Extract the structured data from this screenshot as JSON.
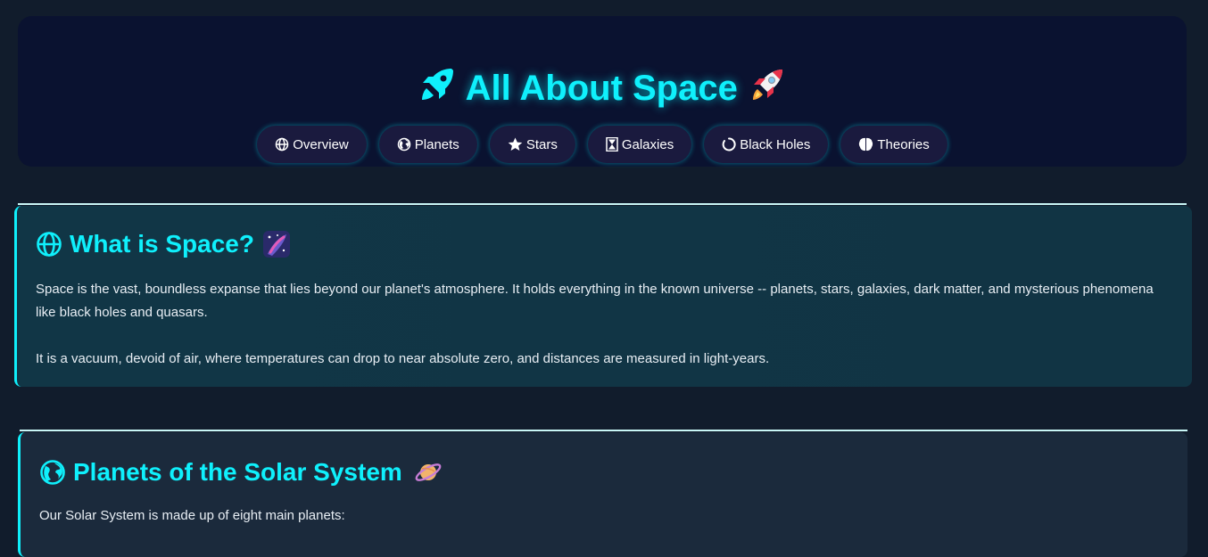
{
  "header": {
    "title": "All About Space",
    "nav": [
      {
        "label": "Overview",
        "icon": "globe-icon"
      },
      {
        "label": "Planets",
        "icon": "earth-icon"
      },
      {
        "label": "Stars",
        "icon": "star-icon"
      },
      {
        "label": "Galaxies",
        "icon": "hourglass-icon"
      },
      {
        "label": "Black Holes",
        "icon": "ring-icon"
      },
      {
        "label": "Theories",
        "icon": "brain-icon"
      }
    ]
  },
  "sections": [
    {
      "heading": "What is Space?",
      "icon": "globe-icon",
      "emoji": "milky-way-icon",
      "paragraphs": [
        "Space is the vast, boundless expanse that lies beyond our planet's atmosphere. It holds everything in the known universe -- planets, stars, galaxies, dark matter, and mysterious phenomena like black holes and quasars.",
        "It is a vacuum, devoid of air, where temperatures can drop to near absolute zero, and distances are measured in light-years."
      ]
    },
    {
      "heading": "Planets of the Solar System",
      "icon": "earth-icon",
      "emoji": "ringed-planet-icon",
      "paragraphs": [
        "Our Solar System is made up of eight main planets:"
      ]
    }
  ],
  "colors": {
    "background": "#111c2c",
    "header_bg": "#0a1230",
    "accent": "#0ff0fc",
    "nav_bg": "#1a1a3e"
  }
}
